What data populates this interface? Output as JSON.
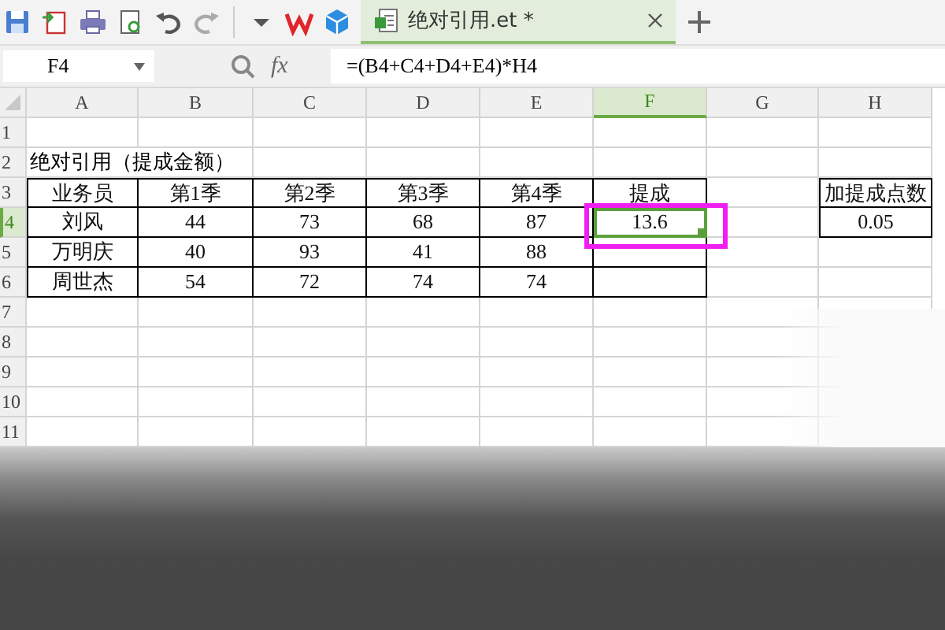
{
  "toolbar": {
    "tab": {
      "title": "绝对引用.et *",
      "selected": true
    }
  },
  "formula_bar": {
    "cell_name": "F4",
    "fx": "fx",
    "formula": "=(B4+C4+D4+E4)*H4"
  },
  "columns": [
    {
      "label": "A",
      "selected": false
    },
    {
      "label": "B",
      "selected": false
    },
    {
      "label": "C",
      "selected": false
    },
    {
      "label": "D",
      "selected": false
    },
    {
      "label": "E",
      "selected": false
    },
    {
      "label": "F",
      "selected": true
    },
    {
      "label": "G",
      "selected": false
    },
    {
      "label": "H",
      "selected": false
    }
  ],
  "rows": [
    {
      "label": "1",
      "selected": false
    },
    {
      "label": "2",
      "selected": false
    },
    {
      "label": "3",
      "selected": false
    },
    {
      "label": "4",
      "selected": true
    },
    {
      "label": "5",
      "selected": false
    },
    {
      "label": "6",
      "selected": false
    },
    {
      "label": "7",
      "selected": false
    },
    {
      "label": "8",
      "selected": false
    },
    {
      "label": "9",
      "selected": false
    },
    {
      "label": "10",
      "selected": false
    },
    {
      "label": "11",
      "selected": false
    }
  ],
  "title": "绝对引用（提成金额）",
  "table": {
    "header": [
      "业务员",
      "第1季",
      "第2季",
      "第3季",
      "第4季",
      "提成"
    ],
    "rows": [
      {
        "name": "刘风",
        "values": [
          "44",
          "73",
          "68",
          "87"
        ],
        "commission": {
          "text": "13.6",
          "selected": true,
          "highlighted": true
        }
      },
      {
        "name": "万明庆",
        "values": [
          "40",
          "93",
          "41",
          "88"
        ]
      },
      {
        "name": "周世杰",
        "values": [
          "54",
          "72",
          "74",
          "74"
        ]
      }
    ]
  },
  "rate_table": {
    "header": "加提成点数",
    "value": "0.05"
  }
}
